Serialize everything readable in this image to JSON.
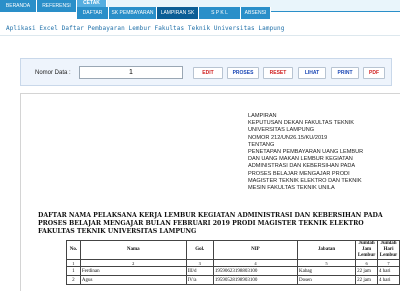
{
  "tabs": {
    "main": [
      "BERANDA",
      "REFERENSI",
      "CETAK"
    ],
    "active_main": "CETAK",
    "sub": [
      "DAFTAR",
      "SK PEMBAYARAN",
      "LAMPIRAN SK",
      "S P K L",
      "ABSENSI"
    ],
    "active_sub": "LAMPIRAN SK"
  },
  "app_title": "Aplikasi Excel Daftar Pembayaran Lembur Fakultas Teknik Universitas Lampung",
  "toolbar": {
    "nomor_label": "Nomor Data :",
    "nomor_value": "1",
    "edit": "EDIT",
    "proses": "PROSES",
    "reset": "RESET",
    "lihat": "LIHAT",
    "print": "PRINT",
    "pdf": "PDF"
  },
  "lampiran": {
    "line1": "LAMPIRAN",
    "line2": "KEPUTUSAN DEKAN FAKULTAS TEKNIK",
    "line3": "UNIVERSITAS LAMPUNG",
    "line4": "NOMOR 212/UN26.15/KU/2019",
    "line5": "TENTANG",
    "line6": "PENETAPAN PEMBAYARAN UANG LEMBUR",
    "line7": "DAN UANG MAKAN LEMBUR KEGIATAN",
    "line8": "ADMINISTRASI DAN KEBERSIHAN PADA",
    "line9": "PROSES BELAJAR MENGAJAR PRODI",
    "line10": "MAGISTER TEKNIK ELEKTRO DAN TEKNIK",
    "line11": "MESIN FAKULTAS TEKNIK UNILA"
  },
  "doc_heading": "DAFTAR NAMA PELAKSANA KERJA LEMBUR KEGIATAN ADMINISTRASI DAN KEBERSIHAN PADA PROSES BELAJAR MENGAJAR BULAN FEBRUARI 2019 PRODI MAGISTER TEKNIK ELEKTRO FAKULTAS TEKNIK UNIVERSITAS LAMPUNG",
  "table": {
    "headers": [
      "No.",
      "Nama",
      "Gol.",
      "NIP",
      "Jabatan",
      "Jumlah Jam Lembur",
      "Jumlah Hari Lembur"
    ],
    "numbers": [
      "1",
      "2",
      "3",
      "4",
      "5",
      "6",
      "7"
    ],
    "rows": [
      [
        "1",
        "Ferdinan",
        "III/d",
        "19590623198803100",
        "Kabag",
        "22 jam",
        "4 hari"
      ],
      [
        "2",
        "Agus",
        "IV/a",
        "19590528198903100",
        "Dosen",
        "22 jam",
        "4 hari"
      ]
    ]
  }
}
